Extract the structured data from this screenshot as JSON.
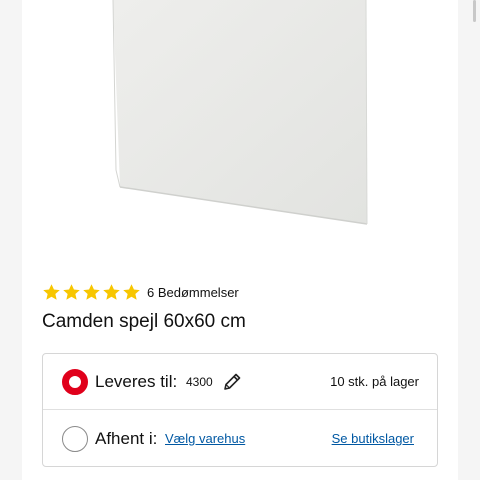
{
  "product": {
    "rating": {
      "stars": 5,
      "count_label": "6 Bedømmelser"
    },
    "title": "Camden spejl 60x60 cm"
  },
  "delivery": {
    "option_delivery": {
      "label": "Leveres til:",
      "postal_code": "4300",
      "stock": "10 stk. på lager",
      "selected": true,
      "edit_icon": "pencil-icon"
    },
    "option_pickup": {
      "label": "Afhent i:",
      "store_link": "Vælg varehus",
      "stock_link": "Se butikslager",
      "selected": false
    }
  },
  "colors": {
    "accent_red": "#e0001b",
    "star_yellow": "#f7c600",
    "link_blue": "#0058a3"
  }
}
